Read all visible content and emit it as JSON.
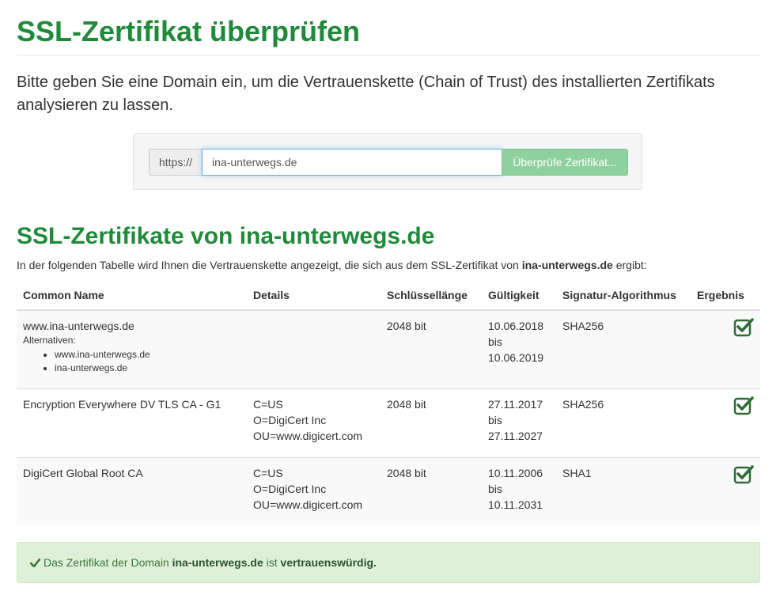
{
  "page": {
    "title": "SSL-Zertifikat überprüfen",
    "lead": "Bitte geben Sie eine Domain ein, um die Vertrauenskette (Chain of Trust) des installierten Zertifikats analysieren zu lassen."
  },
  "form": {
    "prefix": "https://",
    "domain_value": "ina-unterwegs.de",
    "submit_label": "Überprüfe Zertifikat..."
  },
  "results": {
    "heading": "SSL-Zertifikate von ina-unterwegs.de",
    "intro_before": "In der folgenden Tabelle wird Ihnen die Vertrauenskette angezeigt, die sich aus dem SSL-Zertifikat von ",
    "intro_domain": "ina-unterwegs.de",
    "intro_after": " ergibt:",
    "columns": [
      "Common Name",
      "Details",
      "Schlüssellänge",
      "Gültigkeit",
      "Signatur-Algorithmus",
      "Ergebnis"
    ],
    "rows": [
      {
        "common_name": "www.ina-unterwegs.de",
        "alternatives_label": "Alternativen:",
        "alternatives": [
          "www.ina-unterwegs.de",
          "ina-unterwegs.de"
        ],
        "details": [
          "",
          "",
          ""
        ],
        "key_length": "2048 bit",
        "valid_from": "10.06.2018",
        "valid_sep": "bis",
        "valid_to": "10.06.2019",
        "algorithm": "SHA256",
        "result_icon": "checkbox-checked-icon"
      },
      {
        "common_name": "Encryption Everywhere DV TLS CA - G1",
        "details": [
          "C=US",
          "O=DigiCert Inc",
          "OU=www.digicert.com"
        ],
        "key_length": "2048 bit",
        "valid_from": "27.11.2017",
        "valid_sep": "bis",
        "valid_to": "27.11.2027",
        "algorithm": "SHA256",
        "result_icon": "checkbox-checked-icon"
      },
      {
        "common_name": "DigiCert Global Root CA",
        "details": [
          "C=US",
          "O=DigiCert Inc",
          "OU=www.digicert.com"
        ],
        "key_length": "2048 bit",
        "valid_from": "10.11.2006",
        "valid_sep": "bis",
        "valid_to": "10.11.2031",
        "algorithm": "SHA1",
        "result_icon": "checkbox-checked-icon"
      }
    ]
  },
  "alert": {
    "icon": "check-icon",
    "text_before": "Das Zertifikat der Domain ",
    "domain": "ina-unterwegs.de",
    "text_middle": " ist ",
    "verdict": "vertrauenswürdig."
  },
  "colors": {
    "heading_green": "#1e8a3a",
    "button_green": "#8fd19e",
    "alert_bg": "#dff0d8",
    "alert_text": "#3c763d",
    "icon_green": "#2e6b35"
  }
}
